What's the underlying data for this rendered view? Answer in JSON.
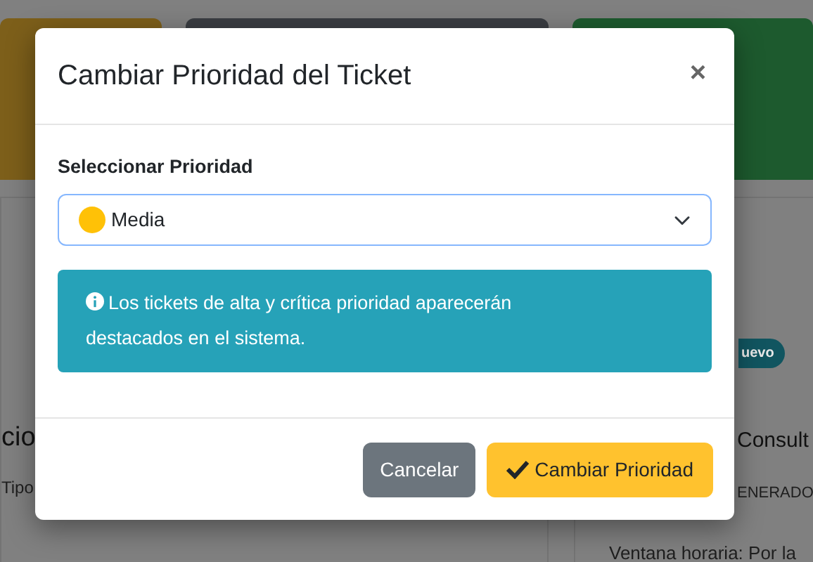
{
  "background": {
    "left_card": {
      "title": "cio",
      "line": "Tipo"
    },
    "right_card": {
      "badge": "uevo",
      "title": "Consult",
      "line_1": "ENERADO",
      "line_2": "Ventana horaria: Por la"
    }
  },
  "modal": {
    "title": "Cambiar Prioridad del Ticket",
    "close": "×",
    "label": "Seleccionar Prioridad",
    "select": {
      "value": "Media",
      "color": "#ffc107"
    },
    "alert": "Los tickets de alta y crítica prioridad aparecerán destacados en el sistema.",
    "buttons": [
      {
        "label": "Cancelar",
        "kind": "secondary"
      },
      {
        "label": "Cambiar Prioridad",
        "kind": "primary"
      }
    ]
  }
}
